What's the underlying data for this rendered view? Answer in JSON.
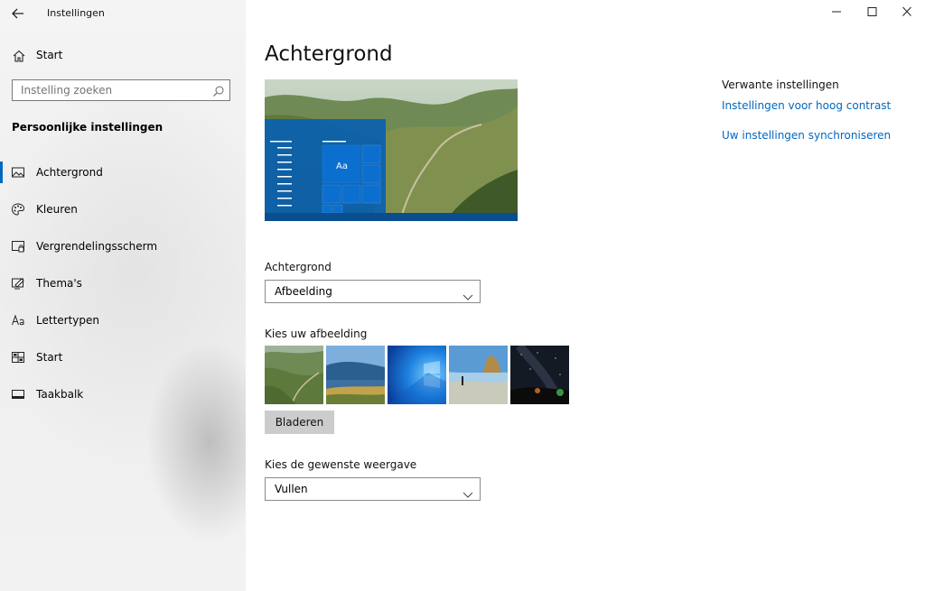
{
  "window": {
    "app_title": "Instellingen",
    "controls": [
      "minimize-icon",
      "maximize-icon",
      "close-icon"
    ]
  },
  "sidebar": {
    "home_label": "Start",
    "search_placeholder": "Instelling zoeken",
    "section_title": "Persoonlijke instellingen",
    "items": [
      {
        "label": "Achtergrond",
        "icon": "image-icon",
        "active": true
      },
      {
        "label": "Kleuren",
        "icon": "palette-icon",
        "active": false
      },
      {
        "label": "Vergrendelingsscherm",
        "icon": "lock-screen-icon",
        "active": false
      },
      {
        "label": "Thema's",
        "icon": "themes-icon",
        "active": false
      },
      {
        "label": "Lettertypen",
        "icon": "font-icon",
        "active": false
      },
      {
        "label": "Start",
        "icon": "start-icon",
        "active": false
      },
      {
        "label": "Taakbalk",
        "icon": "taskbar-icon",
        "active": false
      }
    ]
  },
  "main": {
    "title": "Achtergrond",
    "preview_tile_text": "Aa",
    "background_label": "Achtergrond",
    "background_value": "Afbeelding",
    "choose_image_label": "Kies uw afbeelding",
    "browse_label": "Bladeren",
    "fit_label": "Kies de gewenste weergave",
    "fit_value": "Vullen"
  },
  "related": {
    "title": "Verwante instellingen",
    "links": [
      "Instellingen voor hoog contrast",
      "Uw instellingen synchroniseren"
    ]
  },
  "colors": {
    "accent": "#0067c0",
    "tile_blue": "#0a6fc9",
    "browse_button": "#cccccc"
  }
}
